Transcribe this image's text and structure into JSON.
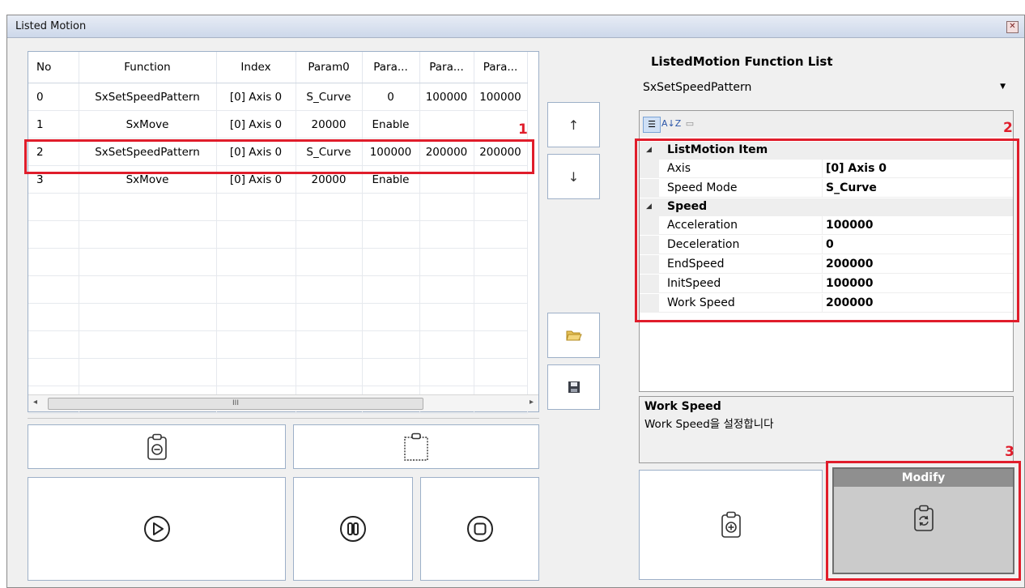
{
  "window": {
    "title": "Listed Motion",
    "close_glyph": "✕"
  },
  "grid": {
    "columns": [
      "No",
      "Function",
      "Index",
      "Param0",
      "Para...",
      "Para...",
      "Para..."
    ],
    "rows": [
      [
        "0",
        "SxSetSpeedPattern",
        "[0] Axis 0",
        "S_Curve",
        "0",
        "100000",
        "100000"
      ],
      [
        "1",
        "SxMove",
        "[0] Axis 0",
        "20000",
        "Enable",
        "",
        ""
      ],
      [
        "2",
        "SxSetSpeedPattern",
        "[0] Axis 0",
        "S_Curve",
        "100000",
        "200000",
        "200000"
      ],
      [
        "3",
        "SxMove",
        "[0] Axis 0",
        "20000",
        "Enable",
        "",
        ""
      ]
    ],
    "scroll_thumb_glyph": "III",
    "scroll_left": "◂",
    "scroll_right": "▸"
  },
  "side_buttons": {
    "up": "↑",
    "down": "↓"
  },
  "annotations": {
    "one": "1",
    "two": "2",
    "three": "3"
  },
  "function_list": {
    "title": "ListedMotion Function List",
    "selected": "SxSetSpeedPattern",
    "dropdown_glyph": "▼"
  },
  "property_grid": {
    "toolbar_sort_glyph": "A↓Z",
    "category_glyph": "☰",
    "pages_glyph": "▭",
    "categories": [
      {
        "label": "ListMotion Item",
        "items": [
          {
            "key": "Axis",
            "value": "[0] Axis 0"
          },
          {
            "key": "Speed Mode",
            "value": "S_Curve"
          }
        ]
      },
      {
        "label": "Speed",
        "items": [
          {
            "key": "Acceleration",
            "value": "100000"
          },
          {
            "key": "Deceleration",
            "value": "0"
          },
          {
            "key": "EndSpeed",
            "value": "200000"
          },
          {
            "key": "InitSpeed",
            "value": "100000"
          },
          {
            "key": "Work Speed",
            "value": "200000"
          }
        ]
      }
    ],
    "collapse_glyph": "◢"
  },
  "description": {
    "title": "Work Speed",
    "text": "Work Speed을 설정합니다"
  },
  "modify": {
    "label": "Modify"
  },
  "colors": {
    "accent_red": "#e01d2b",
    "border_blue": "#9db0c8"
  }
}
